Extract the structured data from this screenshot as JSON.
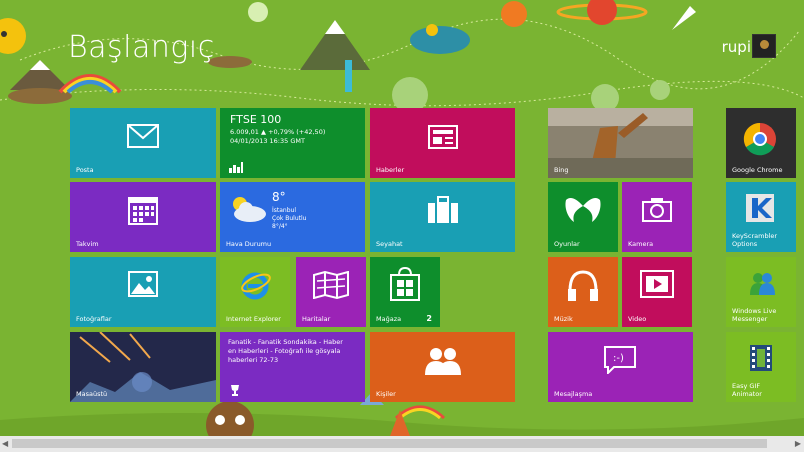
{
  "start": {
    "title": "Başlangıç",
    "user_name": "rupi"
  },
  "tiles": {
    "mail": "Posta",
    "finance": {
      "label": "",
      "index": "FTSE 100",
      "line1": "6.009,01  ▲ +0,79% (+42,50)",
      "line2": "04/01/2013 16:35 GMT"
    },
    "news": "Haberler",
    "bing": "Bing",
    "chrome": "Google Chrome",
    "calendar": "Takvim",
    "weather": {
      "label": "Hava Durumu",
      "temp": "8°",
      "city": "İstanbul",
      "cond": "Çok Bulutlu",
      "range": "8°/4°"
    },
    "travel": "Seyahat",
    "games": "Oyunlar",
    "camera": "Kamera",
    "keyscrambler": "KeyScrambler Options",
    "photos": "Fotoğraflar",
    "ie": "Internet Explorer",
    "maps": "Haritalar",
    "store": {
      "label": "Mağaza",
      "badge": "2"
    },
    "music": "Müzik",
    "video": "Video",
    "messenger": "Windows Live Messenger",
    "desktop": "Masaüstü",
    "sports": {
      "label": "",
      "text": "Fanatik - Fanatik Sondakika - Haber en Haberleri - Fotoğrafı ile gösyala haberleri 72-73"
    },
    "people": "Kişiler",
    "messaging": "Mesajlaşma",
    "gif": "Easy GIF Animator"
  },
  "colors": {
    "background": "#7ab432",
    "accent": "#199fb4"
  }
}
